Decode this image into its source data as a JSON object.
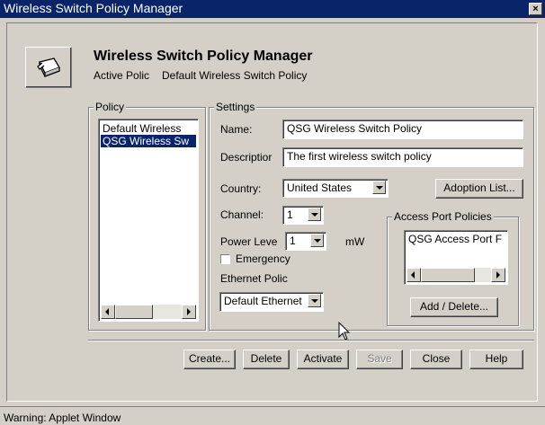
{
  "window": {
    "title": "Wireless Switch Policy Manager",
    "close_glyph": "×"
  },
  "header": {
    "icon": "switch-device-icon",
    "title": "Wireless Switch Policy Manager",
    "active_policy_label": "Active Polic",
    "active_policy_value": "Default Wireless Switch Policy"
  },
  "policy": {
    "group_label": "Policy",
    "items": [
      {
        "label": "Default Wireless",
        "selected": false
      },
      {
        "label": "QSG Wireless Sw",
        "selected": true
      }
    ]
  },
  "settings": {
    "group_label": "Settings",
    "name_label": "Name:",
    "name_value": "QSG Wireless Switch Policy",
    "description_label": "Descriptior",
    "description_value": "The first wireless switch policy",
    "country_label": "Country:",
    "country_value": "United States",
    "adoption_button": "Adoption List...",
    "channel_label": "Channel:",
    "channel_value": "1",
    "power_label": "Power Leve",
    "power_value": "1",
    "power_unit": "mW",
    "emergency_label": "Emergency",
    "emergency_checked": false,
    "ethernet_label": "Ethernet Polic",
    "ethernet_value": "Default Ethernet"
  },
  "access_ports": {
    "group_label": "Access Port Policies",
    "items": [
      "QSG Access Port F"
    ],
    "add_delete_button": "Add / Delete..."
  },
  "buttons": {
    "create": "Create...",
    "delete": "Delete",
    "activate": "Activate",
    "save": "Save",
    "close": "Close",
    "help": "Help"
  },
  "status": {
    "text": "Warning: Applet Window"
  }
}
